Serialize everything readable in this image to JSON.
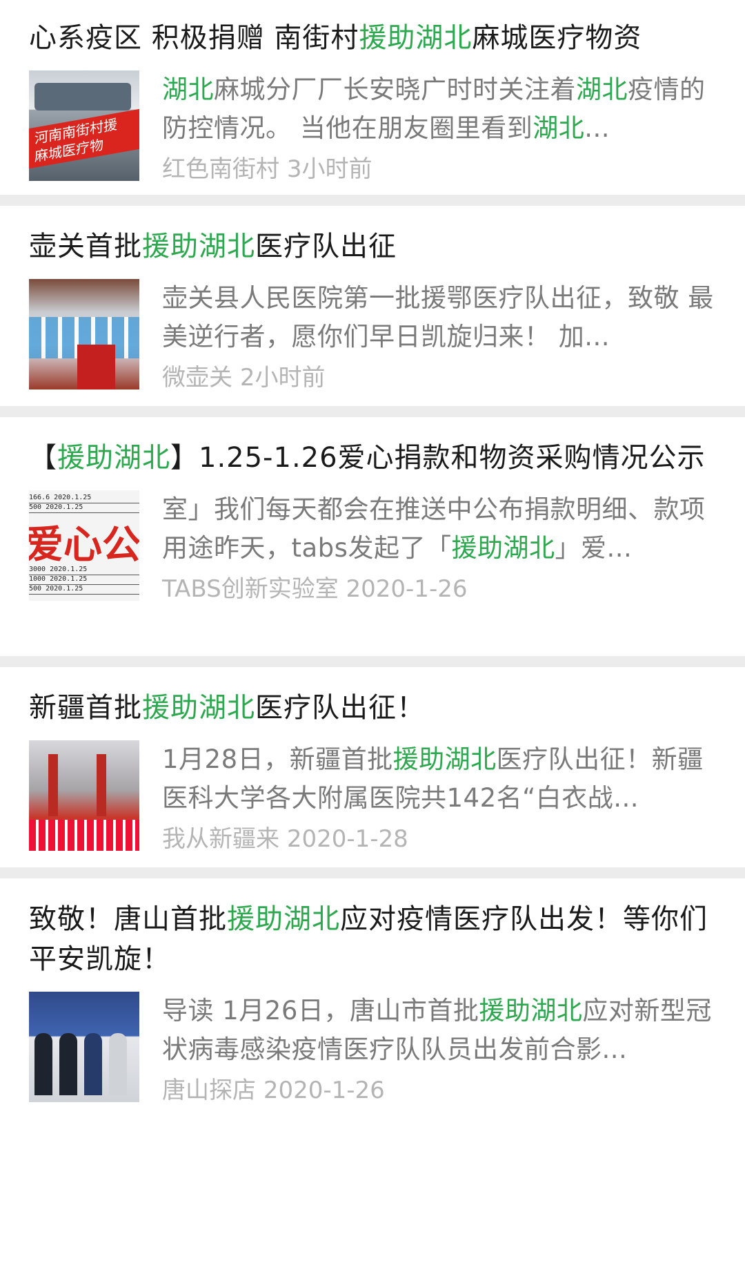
{
  "colors": {
    "highlight": "#2ea84f",
    "meta": "#b4b4b4",
    "separator": "#ececec"
  },
  "articles": [
    {
      "title": [
        {
          "text": "心系疫区 积极捐赠 南街村",
          "hl": false
        },
        {
          "text": "援助湖北",
          "hl": true
        },
        {
          "text": "麻城医疗物资",
          "hl": false
        }
      ],
      "desc": [
        {
          "text": "湖北",
          "hl": true
        },
        {
          "text": "麻城分厂厂长安晓广时时关注着",
          "hl": false
        },
        {
          "text": "湖北",
          "hl": true
        },
        {
          "text": "疫情的防控情况。 当他在朋友圈里看到",
          "hl": false
        },
        {
          "text": "湖北",
          "hl": true
        },
        {
          "text": "...",
          "hl": false
        }
      ],
      "source": "红色南街村",
      "time": "3小时前",
      "thumb": "van-with-red-banner",
      "thumb_text": "河南南街村援 麻城医疗物"
    },
    {
      "title": [
        {
          "text": "壶关首批",
          "hl": false
        },
        {
          "text": "援助湖北",
          "hl": true
        },
        {
          "text": "医疗队出征",
          "hl": false
        }
      ],
      "desc": [
        {
          "text": "壶关县人民医院第一批援鄂医疗队出征，致敬 最美逆行者，愿你们早日凯旋归来！ 加...",
          "hl": false
        }
      ],
      "source": "微壶关",
      "time": "2小时前",
      "thumb": "medical-team-photo"
    },
    {
      "title": [
        {
          "text": "【",
          "hl": false
        },
        {
          "text": "援助湖北",
          "hl": true
        },
        {
          "text": "】1.25-1.26爱心捐款和物资采购情况公示",
          "hl": false
        }
      ],
      "desc": [
        {
          "text": "室」我们每天都会在推送中公布捐款明细、款项用途昨天，tabs发起了「",
          "hl": false
        },
        {
          "text": "援助湖北",
          "hl": true
        },
        {
          "text": "」爱...",
          "hl": false
        }
      ],
      "source": "TABS创新实验室",
      "time": "2020-1-26",
      "thumb": "donation-table-notice",
      "thumb_text": "爱心公告",
      "thumb_rows": [
        "166.6   2020.1.25",
        "500     2020.1.25",
        "3000    2020.1.25",
        "1000    2020.1.25",
        "500     2020.1.25"
      ]
    },
    {
      "title": [
        {
          "text": "新疆首批",
          "hl": false
        },
        {
          "text": "援助湖北",
          "hl": true
        },
        {
          "text": "医疗队出征！",
          "hl": false
        }
      ],
      "desc": [
        {
          "text": "1月28日，新疆首批",
          "hl": false
        },
        {
          "text": "援助湖北",
          "hl": true
        },
        {
          "text": "医疗队出征！新疆医科大学各大附属医院共142名“白衣战...",
          "hl": false
        }
      ],
      "source": "我从新疆来",
      "time": "2020-1-28",
      "thumb": "xinjiang-team-photo"
    },
    {
      "title": [
        {
          "text": "致敬！唐山首批",
          "hl": false
        },
        {
          "text": "援助湖北",
          "hl": true
        },
        {
          "text": "应对疫情医疗队出发！等你们平安凯旋！",
          "hl": false
        }
      ],
      "desc": [
        {
          "text": "导读 1月26日，唐山市首批",
          "hl": false
        },
        {
          "text": "援助湖北",
          "hl": true
        },
        {
          "text": "应对新型冠状病毒感染疫情医疗队队员出发前合影...",
          "hl": false
        }
      ],
      "source": "唐山探店",
      "time": "2020-1-26",
      "thumb": "tangshan-team-photo"
    }
  ]
}
